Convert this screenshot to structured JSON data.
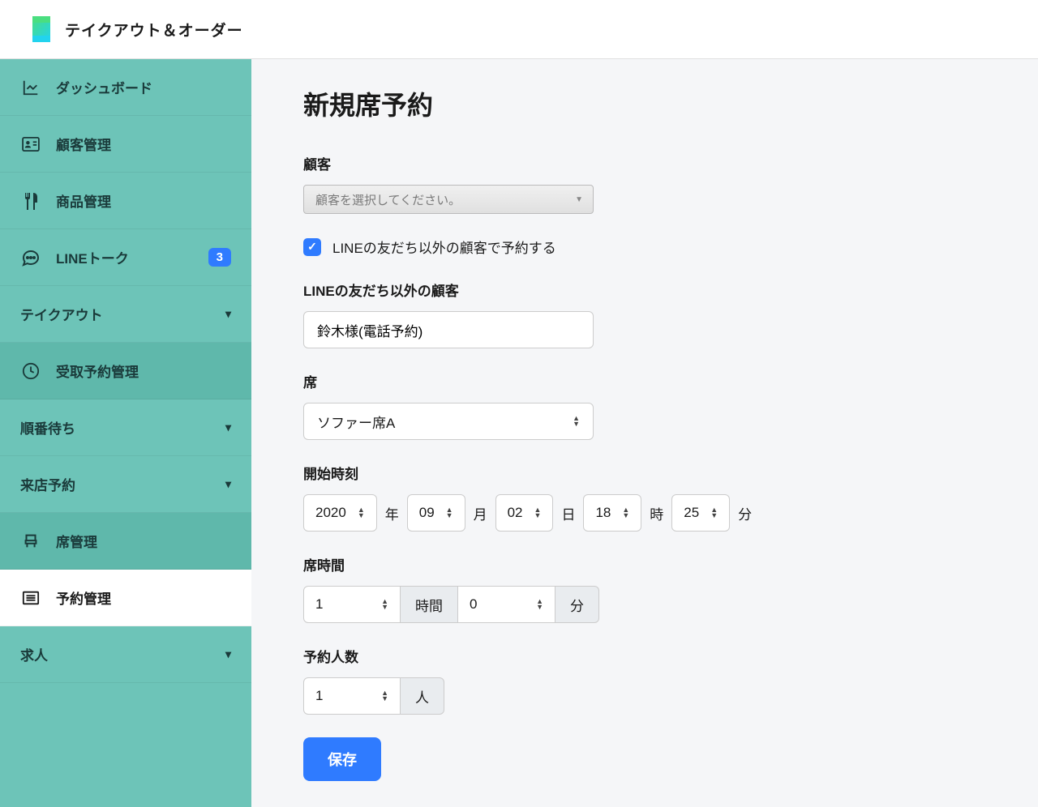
{
  "header": {
    "title": "テイクアウト＆オーダー"
  },
  "sidebar": {
    "items": [
      {
        "label": "ダッシュボード",
        "icon": "chart"
      },
      {
        "label": "顧客管理",
        "icon": "id-card"
      },
      {
        "label": "商品管理",
        "icon": "utensils"
      },
      {
        "label": "LINEトーク",
        "icon": "chat",
        "badge": "3"
      },
      {
        "label": "テイクアウト",
        "expandable": true
      },
      {
        "label": "受取予約管理",
        "icon": "clock",
        "sub": true
      },
      {
        "label": "順番待ち",
        "expandable": true
      },
      {
        "label": "来店予約",
        "expandable": true
      },
      {
        "label": "席管理",
        "icon": "chair",
        "sub": true
      },
      {
        "label": "予約管理",
        "icon": "list",
        "sub": true,
        "active": true
      },
      {
        "label": "求人",
        "expandable": true
      }
    ]
  },
  "page": {
    "title": "新規席予約",
    "customer": {
      "label": "顧客",
      "placeholder": "顧客を選択してください。"
    },
    "checkbox": {
      "label": "LINEの友だち以外の顧客で予約する",
      "checked": true
    },
    "altCustomer": {
      "label": "LINEの友だち以外の顧客",
      "value": "鈴木様(電話予約)"
    },
    "seat": {
      "label": "席",
      "value": "ソファー席A"
    },
    "startTime": {
      "label": "開始時刻",
      "year": "2020",
      "yearUnit": "年",
      "month": "09",
      "monthUnit": "月",
      "day": "02",
      "dayUnit": "日",
      "hour": "18",
      "hourUnit": "時",
      "minute": "25",
      "minuteUnit": "分"
    },
    "duration": {
      "label": "席時間",
      "hours": "1",
      "hoursUnit": "時間",
      "minutes": "0",
      "minutesUnit": "分"
    },
    "people": {
      "label": "予約人数",
      "value": "1",
      "unit": "人"
    },
    "save": "保存"
  }
}
